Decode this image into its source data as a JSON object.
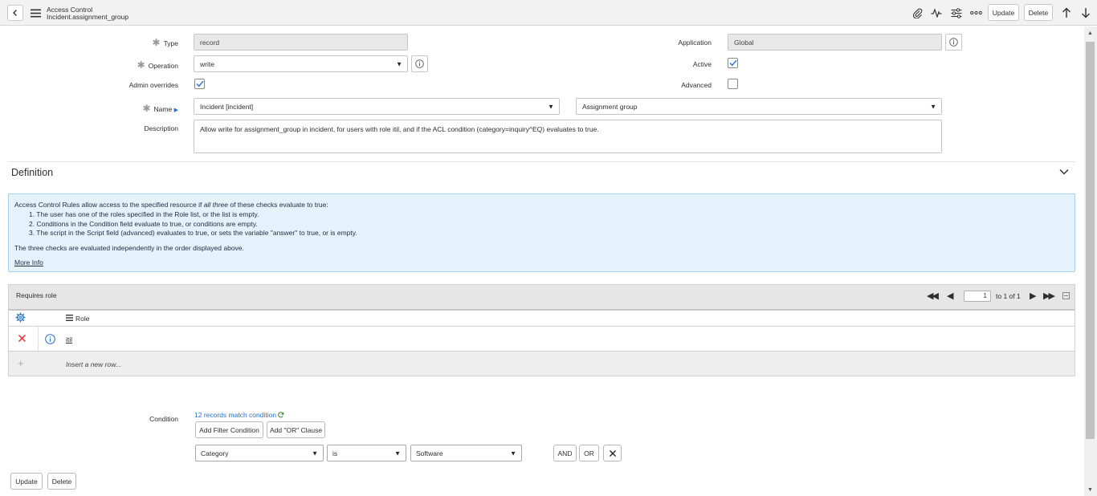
{
  "header": {
    "title_line1": "Access Control",
    "title_line2": "Incident.assignment_group",
    "update_label": "Update",
    "delete_label": "Delete"
  },
  "form": {
    "type_label": "Type",
    "type_value": "record",
    "application_label": "Application",
    "application_value": "Global",
    "operation_label": "Operation",
    "operation_value": "write",
    "active_label": "Active",
    "active_checked": true,
    "admin_overrides_label": "Admin overrides",
    "admin_overrides_checked": true,
    "advanced_label": "Advanced",
    "advanced_checked": false,
    "name_label": "Name",
    "name_table_value": "Incident [incident]",
    "name_field_value": "Assignment group",
    "description_label": "Description",
    "description_value": "Allow write for assignment_group in incident, for users with role itil, and if the ACL condition (category=inquiry^EQ) evaluates to true."
  },
  "definition": {
    "title": "Definition",
    "info": {
      "intro_pre": "Access Control Rules allow access to the specified resource if ",
      "intro_em": "all three",
      "intro_post": " of these checks evaluate to true:",
      "item1_pre": "1. The user has one of the roles specified in the ",
      "item1_kw": "Role",
      "item1_post": " list, or the list is empty.",
      "item2_pre": "2. Conditions in the ",
      "item2_kw": "Condition",
      "item2_post": " field evaluate to true, or conditions are empty.",
      "item3_pre": "3. The script in the ",
      "item3_kw": "Script",
      "item3_post": " field (advanced) evaluates to true, or sets the variable \"answer\" to true, or is empty.",
      "note": "The three checks are evaluated independently in the order displayed above.",
      "more_info": "More Info"
    }
  },
  "related_list": {
    "title": "Requires role",
    "page_value": "1",
    "page_text": "to 1 of 1",
    "column_role": "Role",
    "rows": [
      {
        "role": "itil"
      }
    ],
    "insert_text": "Insert a new row..."
  },
  "condition": {
    "label": "Condition",
    "match_text": "12 records match condition",
    "add_filter": "Add Filter Condition",
    "add_or": "Add \"OR\" Clause",
    "field_value": "Category",
    "operator_value": "is",
    "value_value": "Software",
    "and_label": "AND",
    "or_label": "OR"
  },
  "footer": {
    "update_label": "Update",
    "delete_label": "Delete"
  },
  "colors": {
    "info_bg": "#e5f1fb",
    "link": "#2a6ec6",
    "delete_red": "#e03131",
    "check_blue": "#2b6fd6"
  }
}
